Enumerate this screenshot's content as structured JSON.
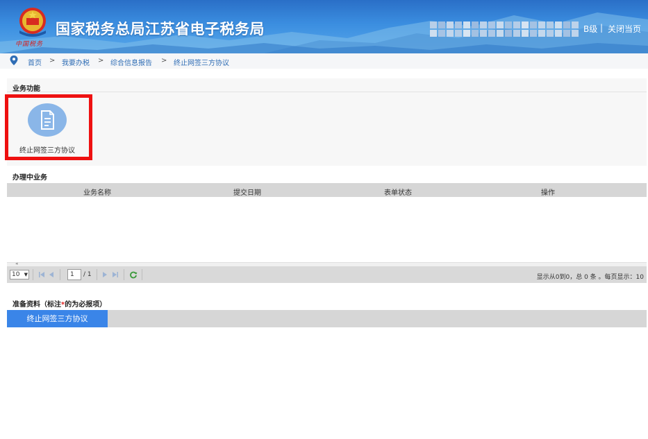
{
  "header": {
    "site_title": "国家税务总局江苏省电子税务局",
    "slogan": "中国税务",
    "user_suffix": "B级",
    "separator": "|",
    "close_label": "关闭当页"
  },
  "breadcrumb": {
    "items": [
      "首页",
      "我要办税",
      "综合信息报告",
      "终止网签三方协议"
    ],
    "separator": ">"
  },
  "business_functions": {
    "title": "业务功能",
    "tiles": [
      {
        "label": "终止网签三方协议",
        "icon": "document-icon"
      }
    ]
  },
  "in_progress": {
    "title": "办理中业务",
    "columns": [
      "业务名称",
      "提交日期",
      "表单状态",
      "操作"
    ],
    "rows": []
  },
  "pager": {
    "page_size": "10",
    "current_page": "1",
    "total_pages": "/ 1",
    "info": "显示从0到0，总 0 条 。每页显示：10"
  },
  "preparation": {
    "title_prefix": "准备资料（标注",
    "title_star": "*",
    "title_suffix": "的为必报项）",
    "tabs": [
      "终止网签三方协议"
    ]
  },
  "colors": {
    "header_blue": "#3b8ee0",
    "active_tab": "#3a85e8",
    "highlight_red": "#ee1111",
    "link_blue": "#2f6db5"
  }
}
